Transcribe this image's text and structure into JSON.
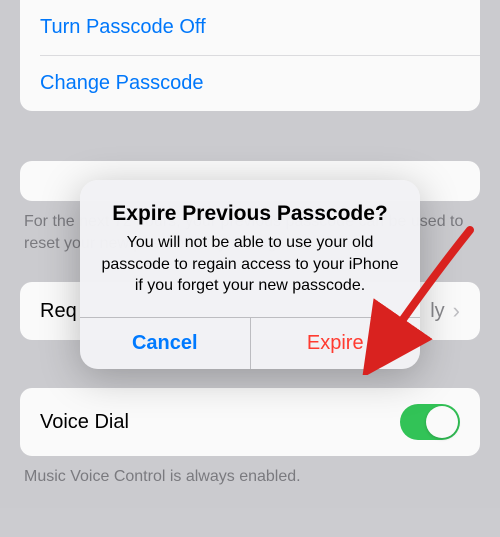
{
  "passcode_group": {
    "turn_off_label": "Turn Passcode Off",
    "change_label": "Change Passcode"
  },
  "note_text": "For the ... sed to reset yo",
  "require_row": {
    "label": "Require Passcode",
    "value": "Immediately"
  },
  "voice_dial": {
    "label": "Voice Dial",
    "footer": "Music Voice Control is always enabled."
  },
  "alert": {
    "title": "Expire Previous Passcode?",
    "message": "You will not be able to use your old passcode to regain access to your iPhone if you forget your new passcode.",
    "cancel_label": "Cancel",
    "confirm_label": "Expire"
  },
  "require_row_visible": {
    "label_truncated": "Req",
    "value_truncated": "ly"
  }
}
